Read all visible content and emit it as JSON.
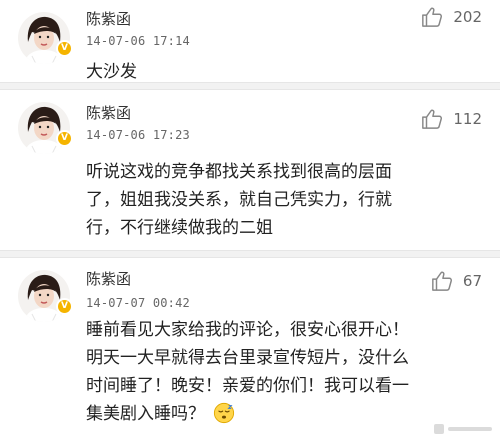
{
  "comments": [
    {
      "author": "陈紫函",
      "time": "14-07-06 17:14",
      "lines": [
        "大沙发"
      ],
      "likes": "202",
      "avatar_icon": "avatar-portrait",
      "badge": "V"
    },
    {
      "author": "陈紫函",
      "time": "14-07-06 17:23",
      "lines": [
        "听说这戏的竞争都找关系找到很高的层面",
        "了，姐姐我没关系，就自己凭实力，行就",
        "行，不行继续做我的二姐"
      ],
      "likes": "112",
      "avatar_icon": "avatar-portrait",
      "badge": "V"
    },
    {
      "author": "陈紫函",
      "time": "14-07-07 00:42",
      "lines": [
        "睡前看见大家给我的评论，很安心很开心！",
        "明天一大早就得去台里录宣传短片，没什么",
        "时间睡了！晚安！亲爱的你们！我可以看一",
        "集美剧入睡吗？"
      ],
      "likes": "67",
      "avatar_icon": "avatar-portrait",
      "badge": "V",
      "emoji": "sleepy-face-emoji"
    }
  ],
  "icons": {
    "like": "thumbs-up-icon"
  },
  "colors": {
    "badge": "#f5b400",
    "divider": "#f2f2f2",
    "meta_text": "#666666"
  }
}
